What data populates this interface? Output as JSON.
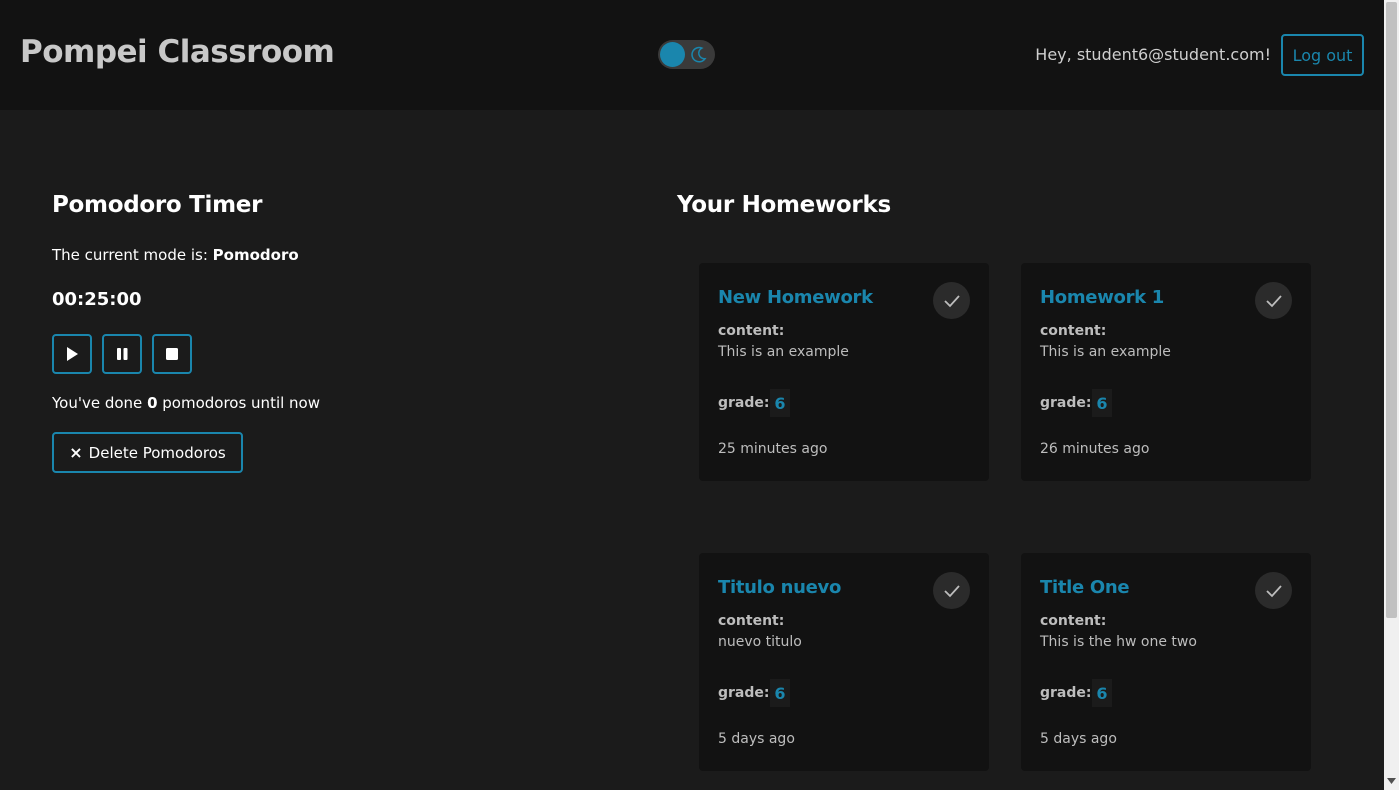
{
  "header": {
    "brand": "Pompei Classroom",
    "greeting": "Hey, student6@student.com!",
    "logout_label": "Log out"
  },
  "pomodoro": {
    "title": "Pomodoro Timer",
    "mode_prefix": "The current mode is: ",
    "mode": "Pomodoro",
    "time": "00:25:00",
    "done_prefix": "You've done ",
    "done_count": "0",
    "done_suffix": " pomodoros until now",
    "delete_icon": "×",
    "delete_label": "Delete Pomodoros"
  },
  "homeworks": {
    "title": "Your Homeworks",
    "content_label": "content:",
    "grade_label": "grade:",
    "items": [
      {
        "title": "New Homework",
        "content": "This is an example",
        "grade": "6",
        "time": "25 minutes ago"
      },
      {
        "title": "Homework 1",
        "content": "This is an example",
        "grade": "6",
        "time": "26 minutes ago"
      },
      {
        "title": "Titulo nuevo",
        "content": "nuevo titulo",
        "grade": "6",
        "time": "5 days ago"
      },
      {
        "title": "Title One",
        "content": "This is the hw one two",
        "grade": "6",
        "time": "5 days ago"
      }
    ]
  },
  "colors": {
    "accent": "#1a86ad",
    "background": "#1b1b1b",
    "header_bg": "#121212",
    "card_bg": "#121212"
  }
}
